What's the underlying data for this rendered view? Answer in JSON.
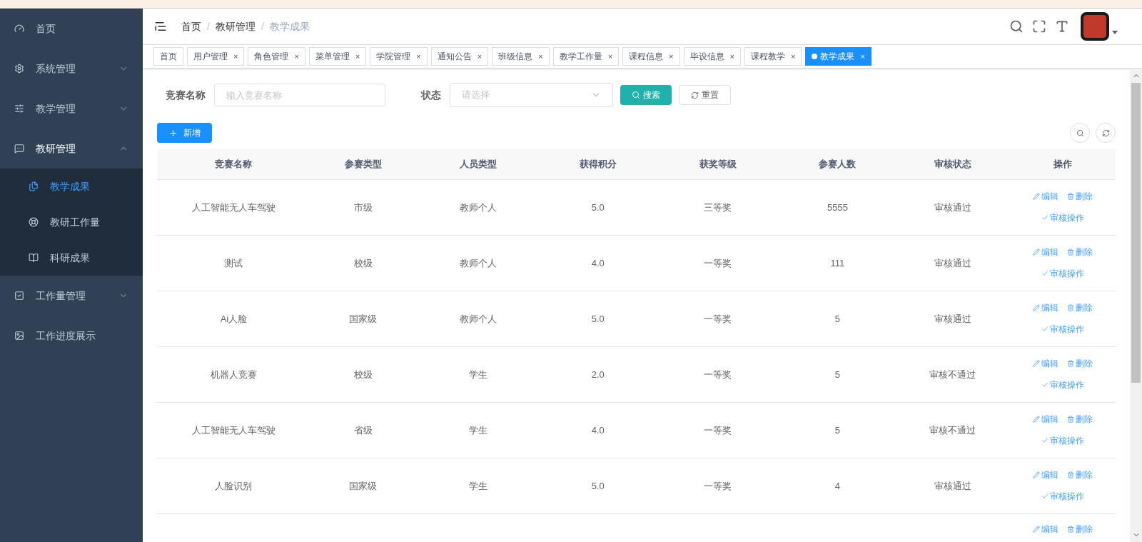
{
  "sidebar": {
    "items": [
      {
        "label": "首页"
      },
      {
        "label": "系统管理",
        "expanded": false
      },
      {
        "label": "教学管理",
        "expanded": false
      },
      {
        "label": "教研管理",
        "expanded": true,
        "children": [
          {
            "label": "教学成果",
            "selected": true
          },
          {
            "label": "教研工作量",
            "selected": false
          },
          {
            "label": "科研成果",
            "selected": false
          }
        ]
      },
      {
        "label": "工作量管理",
        "expanded": false
      },
      {
        "label": "工作进度展示"
      }
    ]
  },
  "breadcrumb": [
    "首页",
    "教研管理",
    "教学成果"
  ],
  "breadcrumb_separator": "/",
  "tabs": [
    {
      "label": "首页",
      "selected": false,
      "closable": false
    },
    {
      "label": "用户管理",
      "selected": false,
      "closable": true
    },
    {
      "label": "角色管理",
      "selected": false,
      "closable": true
    },
    {
      "label": "菜单管理",
      "selected": false,
      "closable": true
    },
    {
      "label": "学院管理",
      "selected": false,
      "closable": true
    },
    {
      "label": "通知公告",
      "selected": false,
      "closable": true
    },
    {
      "label": "班级信息",
      "selected": false,
      "closable": true
    },
    {
      "label": "教学工作量",
      "selected": false,
      "closable": true
    },
    {
      "label": "课程信息",
      "selected": false,
      "closable": true
    },
    {
      "label": "毕设信息",
      "selected": false,
      "closable": true
    },
    {
      "label": "课程教学",
      "selected": false,
      "closable": true
    },
    {
      "label": "教学成果",
      "selected": true,
      "closable": true
    }
  ],
  "close_glyph": "×",
  "filters": {
    "name_label": "竞赛名称",
    "name_placeholder": "输入竞赛名称",
    "status_label": "状态",
    "status_placeholder": "请选择",
    "search_button": "搜索",
    "reset_button": "重置"
  },
  "add_button": "新增",
  "table": {
    "columns": [
      "竞赛名称",
      "参赛类型",
      "人员类型",
      "获得积分",
      "获奖等级",
      "参赛人数",
      "审核状态",
      "操作"
    ],
    "rows": [
      {
        "cells": [
          "人工智能无人车驾驶",
          "市级",
          "教师个人",
          "5.0",
          "三等奖",
          "5555",
          "审核通过"
        ],
        "actions": [
          "编辑",
          "删除",
          "审核操作"
        ]
      },
      {
        "cells": [
          "测试",
          "校级",
          "教师个人",
          "4.0",
          "一等奖",
          "111",
          "审核通过"
        ],
        "actions": [
          "编辑",
          "删除",
          "审核操作"
        ]
      },
      {
        "cells": [
          "Ai人脸",
          "国家级",
          "教师个人",
          "5.0",
          "一等奖",
          "5",
          "审核通过"
        ],
        "actions": [
          "编辑",
          "删除",
          "审核操作"
        ]
      },
      {
        "cells": [
          "机器人竞赛",
          "校级",
          "学生",
          "2.0",
          "一等奖",
          "5",
          "审核不通过"
        ],
        "actions": [
          "编辑",
          "删除",
          "审核操作"
        ]
      },
      {
        "cells": [
          "人工智能无人车驾驶",
          "省级",
          "学生",
          "4.0",
          "一等奖",
          "5",
          "审核不通过"
        ],
        "actions": [
          "编辑",
          "删除",
          "审核操作"
        ]
      },
      {
        "cells": [
          "人脸识别",
          "国家级",
          "学生",
          "5.0",
          "一等奖",
          "4",
          "审核通过"
        ],
        "actions": [
          "编辑",
          "删除",
          "审核操作"
        ]
      },
      {
        "cells": [],
        "actions": [
          "编辑",
          "删除"
        ]
      }
    ]
  }
}
